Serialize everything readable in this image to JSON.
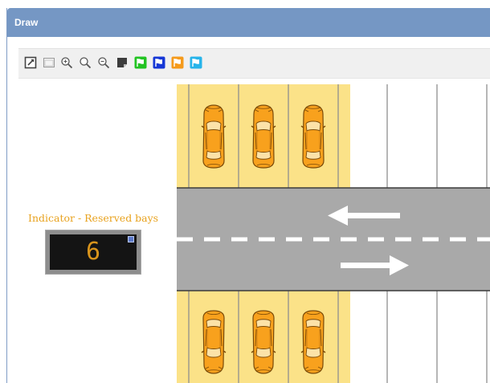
{
  "window": {
    "title": "Draw"
  },
  "toolbar": {
    "buttons": [
      {
        "name": "edit-icon"
      },
      {
        "name": "select-area-icon"
      },
      {
        "name": "zoom-fit-icon"
      },
      {
        "name": "zoom-in-icon"
      },
      {
        "name": "zoom-out-icon"
      },
      {
        "name": "note-icon"
      },
      {
        "name": "flag-green-icon",
        "color": "#22c322"
      },
      {
        "name": "flag-blue-icon",
        "color": "#1537d6"
      },
      {
        "name": "flag-orange-icon",
        "color": "#f59a1b"
      },
      {
        "name": "flag-cyan-icon",
        "color": "#27b4ea"
      }
    ]
  },
  "indicator": {
    "label": "Indicator - Reserved bays",
    "value": "6"
  },
  "parking": {
    "reserved_color": "#fbe288",
    "car_color": "#f8a11d",
    "road_color": "#a9a9a9",
    "top_row_cars": 3,
    "bottom_row_cars": 3
  }
}
